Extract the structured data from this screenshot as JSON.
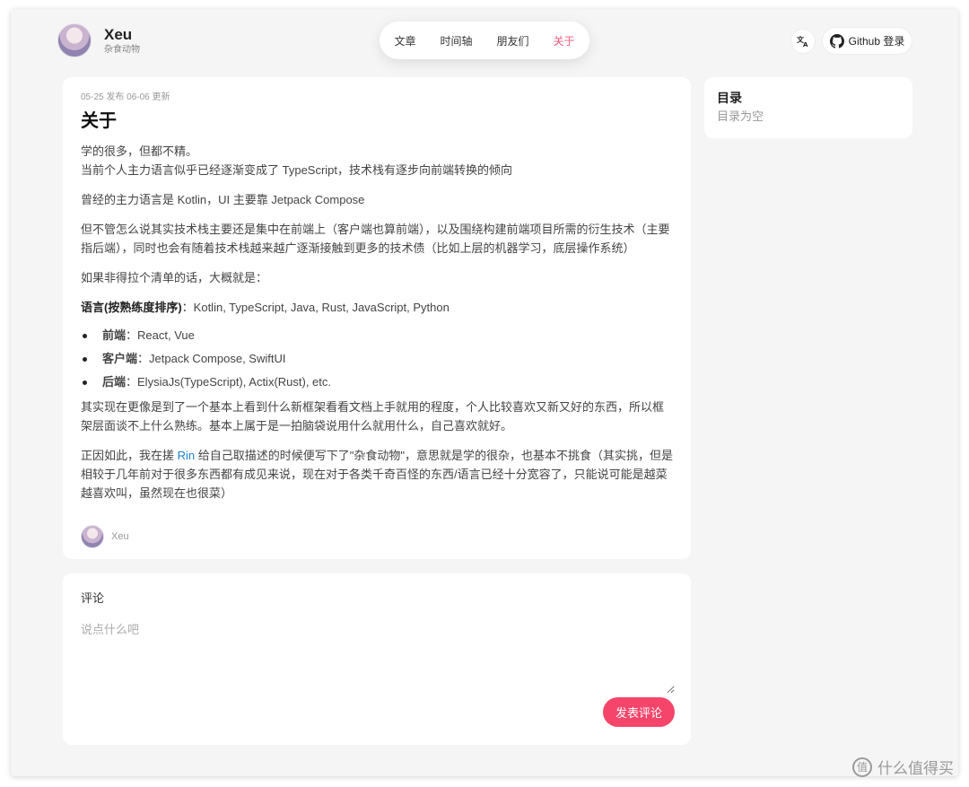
{
  "header": {
    "site_name": "Xeu",
    "site_subtitle": "杂食动物",
    "nav": [
      {
        "label": "文章",
        "active": false
      },
      {
        "label": "时间轴",
        "active": false
      },
      {
        "label": "朋友们",
        "active": false
      },
      {
        "label": "关于",
        "active": true
      }
    ],
    "lang_icon": "文A",
    "github_login": "Github 登录"
  },
  "article": {
    "meta": "05-25 发布 06-06 更新",
    "title": "关于",
    "p1_line1": "学的很多，但都不精。",
    "p1_line2": "当前个人主力语言似乎已经逐渐变成了 TypeScript，技术栈有逐步向前端转换的倾向",
    "p2": "曾经的主力语言是 Kotlin，UI 主要靠 Jetpack Compose",
    "p3": "但不管怎么说其实技术栈主要还是集中在前端上（客户端也算前端），以及围绕构建前端项目所需的衍生技术（主要指后端），同时也会有随着技术栈越来越广逐渐接触到更多的技术债（比如上层的机器学习，底层操作系统）",
    "p4": "如果非得拉个清单的话，大概就是：",
    "lang_label": "语言(按熟练度排序)",
    "lang_value": "：Kotlin, TypeScript, Java, Rust, JavaScript, Python",
    "list": [
      {
        "label": "前端",
        "value": "：React, Vue"
      },
      {
        "label": "客户端",
        "value": "：Jetpack Compose, SwiftUI"
      },
      {
        "label": "后端",
        "value": "：ElysiaJs(TypeScript), Actix(Rust), etc."
      }
    ],
    "p5": "其实现在更像是到了一个基本上看到什么新框架看看文档上手就用的程度，个人比较喜欢又新又好的东西，所以框架层面谈不上什么熟练。基本上属于是一拍脑袋说用什么就用什么，自己喜欢就好。",
    "p6_pre": "正因如此，我在搓 ",
    "p6_link": "Rin",
    "p6_post": " 给自己取描述的时候便写下了\"杂食动物\"，意思就是学的很杂，也基本不挑食（其实挑，但是相较于几年前对于很多东西都有成见来说，现在对于各类千奇百怪的东西/语言已经十分宽容了，只能说可能是越菜越喜欢叫，虽然现在也很菜）",
    "author": "Xeu"
  },
  "toc": {
    "title": "目录",
    "empty": "目录为空"
  },
  "comments": {
    "title": "评论",
    "placeholder": "说点什么吧",
    "submit": "发表评论"
  },
  "watermark": {
    "badge": "值",
    "text": "什么值得买"
  },
  "colors": {
    "accent": "#f5587b",
    "submit_bg": "#f5456a",
    "link": "#1e7fd0",
    "page_bg": "#f5f5f5"
  }
}
